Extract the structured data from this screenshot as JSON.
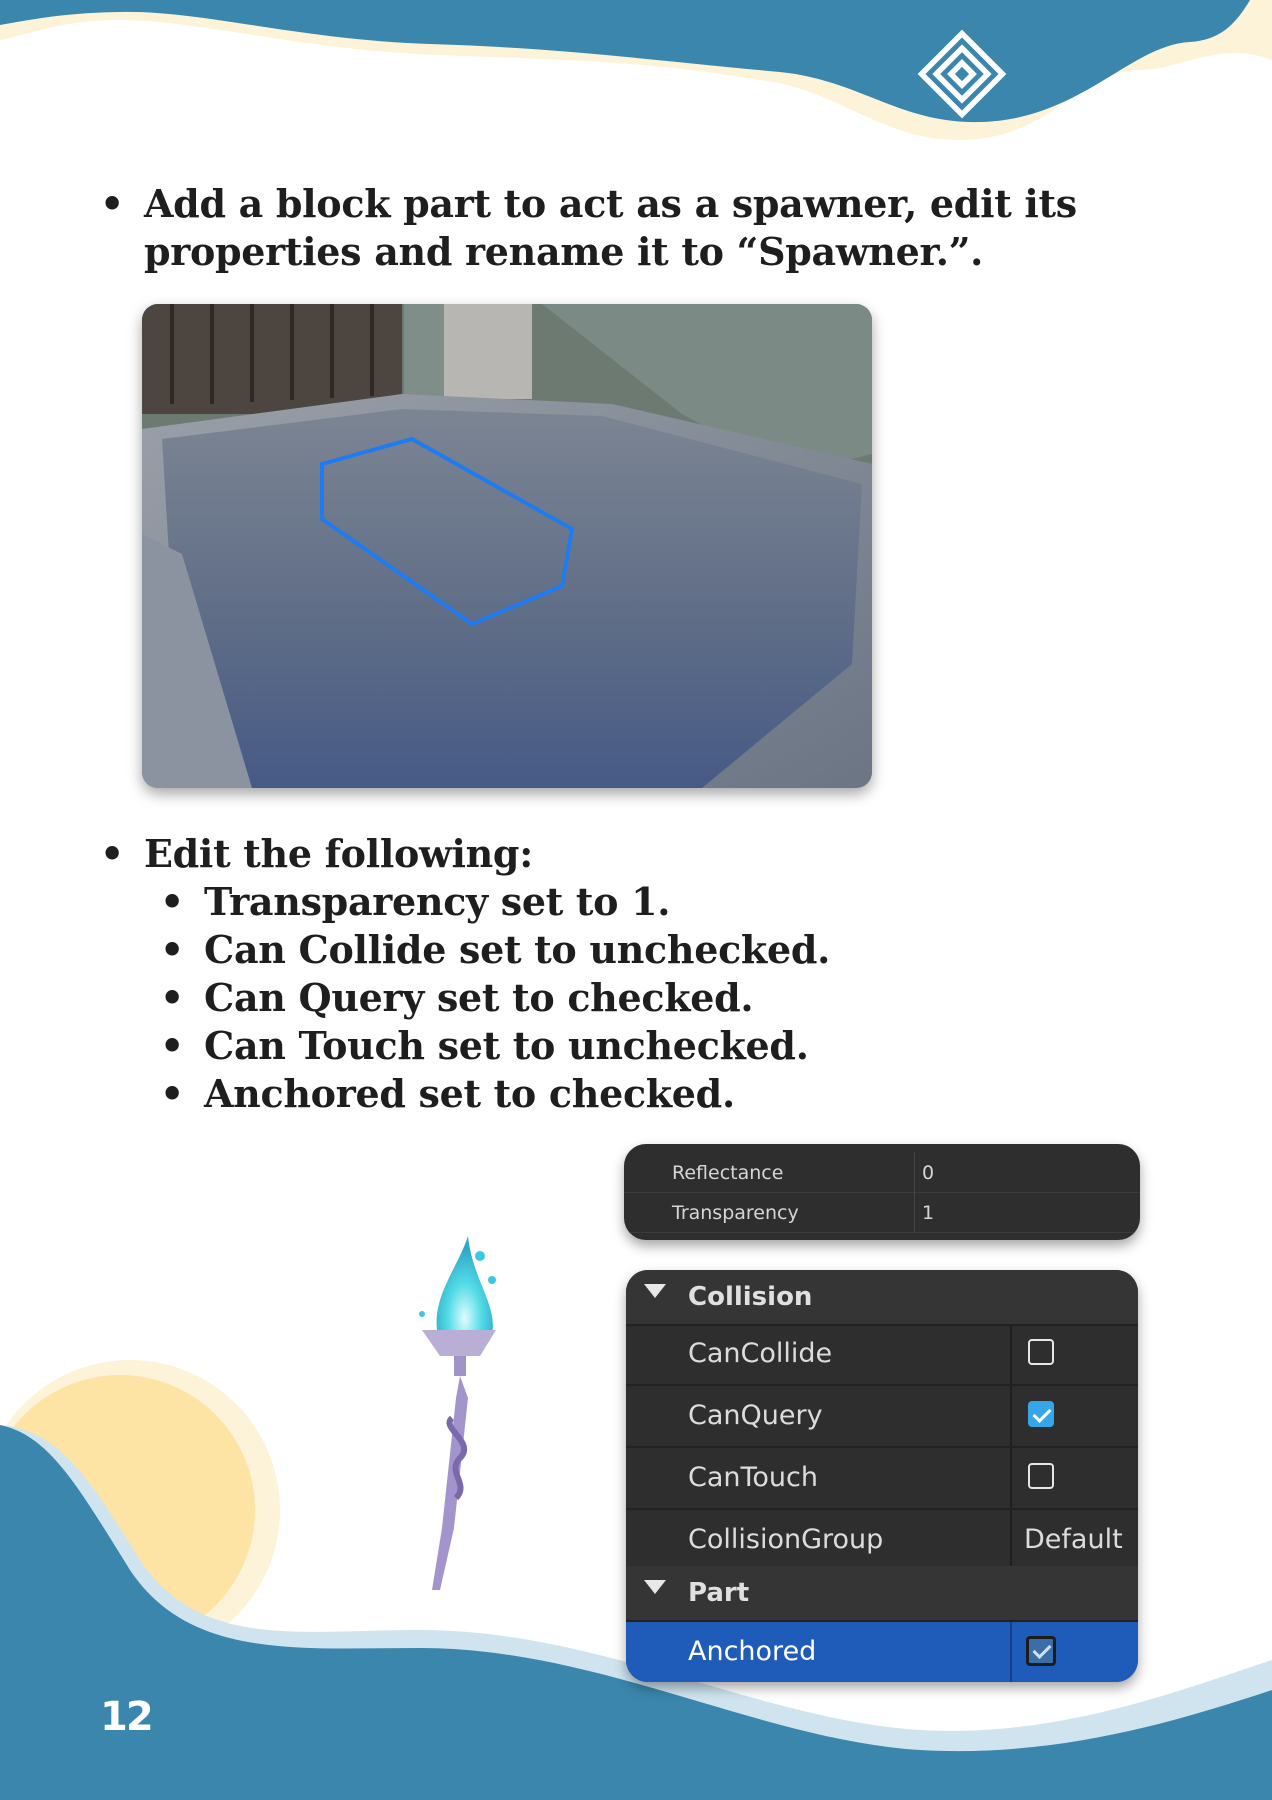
{
  "bullets": {
    "first": "Add a block part to act as a spawner, edit its properties and rename it to “Spawner.”.",
    "second_heading": "Edit the following:",
    "sub_items": [
      "Transparency set to 1.",
      "Can Collide set to unchecked.",
      "Can Query set to checked.",
      "Can Touch set to unchecked.",
      "Anchored set to checked."
    ],
    "bullet_glyph": "•"
  },
  "properties_small": {
    "rows": [
      {
        "label": "Reflectance",
        "value": "0"
      },
      {
        "label": "Transparency",
        "value": "1"
      }
    ]
  },
  "properties_big": {
    "collision_header": "Collision",
    "collision_rows": [
      {
        "label": "CanCollide",
        "checked": false
      },
      {
        "label": "CanQuery",
        "checked": true
      },
      {
        "label": "CanTouch",
        "checked": false
      },
      {
        "label": "CollisionGroup",
        "value": "Default"
      }
    ],
    "part_header": "Part",
    "part_rows": [
      {
        "label": "Anchored",
        "checked": true,
        "selected": true
      }
    ]
  },
  "page_number": "12",
  "colors": {
    "wave_blue": "#3a86ad",
    "wave_cream": "#fdf3d8",
    "sun_yellow": "#fde3a4",
    "panel_dark": "#2e2e2e",
    "selection_blue": "#1f5bb8",
    "checkbox_blue": "#35a7e8",
    "outline_blue": "#1e7bf0"
  },
  "icons": [
    "diamond-logo-icon",
    "magic-staff-illustration",
    "expand-triangle-icon",
    "checkbox-icon"
  ]
}
